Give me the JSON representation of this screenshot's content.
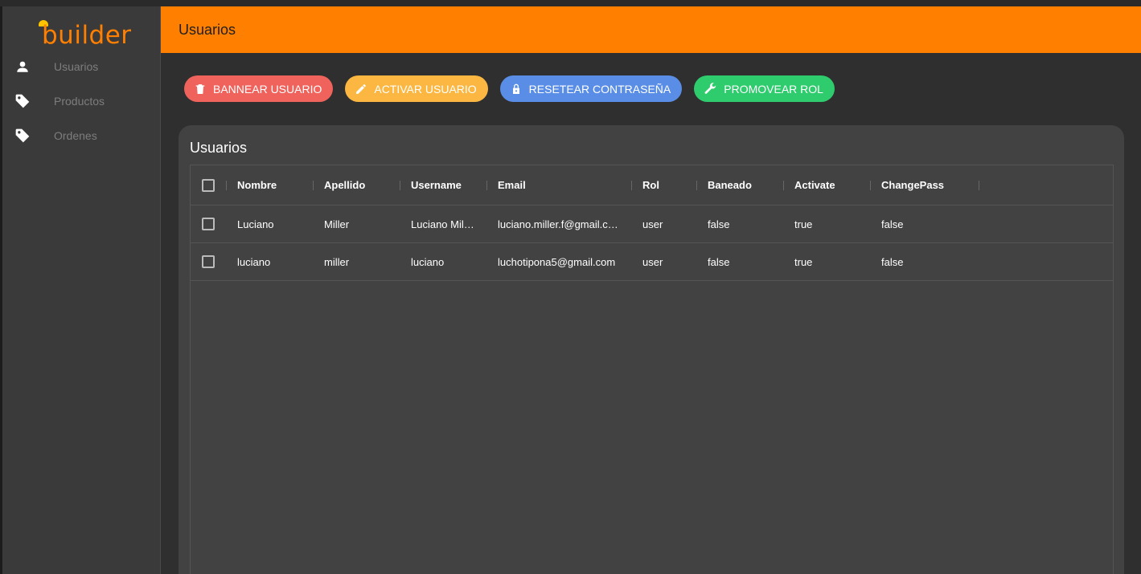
{
  "app": {
    "logo_text": "builder"
  },
  "sidebar": {
    "items": [
      {
        "label": "Usuarios",
        "icon": "person-icon"
      },
      {
        "label": "Productos",
        "icon": "tag-icon"
      },
      {
        "label": "Ordenes",
        "icon": "tag-icon"
      }
    ]
  },
  "header": {
    "title": "Usuarios"
  },
  "actions": [
    {
      "label": "BANNEAR USUARIO",
      "icon": "trash-icon",
      "color": "#f0635c"
    },
    {
      "label": "ACTIVAR USUARIO",
      "icon": "pencil-icon",
      "color": "#fbb742"
    },
    {
      "label": "RESETEAR CONTRASEÑA",
      "icon": "lock-icon",
      "color": "#5a8ee6"
    },
    {
      "label": "PROMOVEAR ROL",
      "icon": "wrench-icon",
      "color": "#2fcc6e"
    }
  ],
  "table": {
    "title": "Usuarios",
    "columns": [
      "Nombre",
      "Apellido",
      "Username",
      "Email",
      "Rol",
      "Baneado",
      "Activate",
      "ChangePass"
    ],
    "rows": [
      [
        "Luciano",
        "Miller",
        "Luciano Mil…",
        "luciano.miller.f@gmail.c…",
        "user",
        "false",
        "true",
        "false"
      ],
      [
        "luciano",
        "miller",
        "luciano",
        "luchotipona5@gmail.com",
        "user",
        "false",
        "true",
        "false"
      ]
    ]
  },
  "colors": {
    "accent": "#ff8000",
    "sidebar_bg": "#3a3a3a",
    "card_bg": "#424242"
  }
}
